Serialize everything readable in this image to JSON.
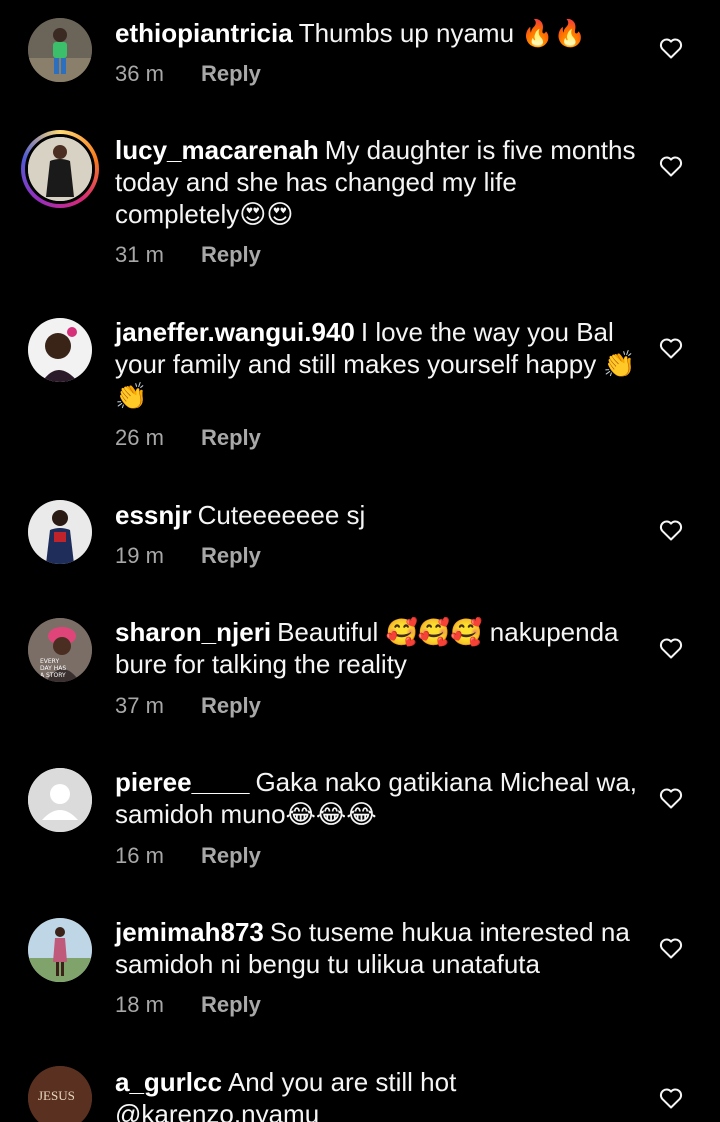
{
  "comments": [
    {
      "username": "ethiopiantricia",
      "text": "Thumbs up nyamu 🔥🔥",
      "time": "36 m",
      "reply": "Reply",
      "avatar": "person-standing-avatar"
    },
    {
      "username": "lucy_macarenah",
      "text": "My daughter is five months today and she has changed my life completely😍😍",
      "time": "31 m",
      "reply": "Reply",
      "avatar": "woman-black-dress-avatar",
      "story_ring": true
    },
    {
      "username": "janeffer.wangui.940",
      "text": "I love the way you Bal your family and still makes yourself happy 👏👏",
      "time": "26 m",
      "reply": "Reply",
      "avatar": "woman-selfie-avatar"
    },
    {
      "username": "essnjr",
      "text": "Cuteeeeeee sj",
      "time": "19 m",
      "reply": "Reply",
      "avatar": "woman-red-top-avatar"
    },
    {
      "username": "sharon_njeri",
      "text": "Beautiful 🥰🥰🥰 nakupenda bure for talking the reality",
      "time": "37 m",
      "reply": "Reply",
      "avatar": "woman-pink-headwrap-avatar",
      "avatar_text": "EVERY DAY HAS A STORY"
    },
    {
      "username": "pieree____",
      "text": "Gaka nako gatikiana Micheal wa, samidoh muno😂😂😂",
      "time": "16 m",
      "reply": "Reply",
      "avatar": "default-user-avatar"
    },
    {
      "username": "jemimah873",
      "text": "So tuseme hukua interested na samidoh ni bengu tu ulikua unatafuta",
      "time": "18 m",
      "reply": "Reply",
      "avatar": "woman-outdoor-avatar"
    },
    {
      "username": "a_gurlcc",
      "text": "And you are still hot @karenzo.nyamu",
      "time": "",
      "reply": "",
      "avatar": "jesus-text-avatar",
      "avatar_text": "JESUS"
    }
  ],
  "colors": {
    "background": "#000000",
    "text": "#f5f5f5",
    "meta": "#a8a8a8"
  }
}
